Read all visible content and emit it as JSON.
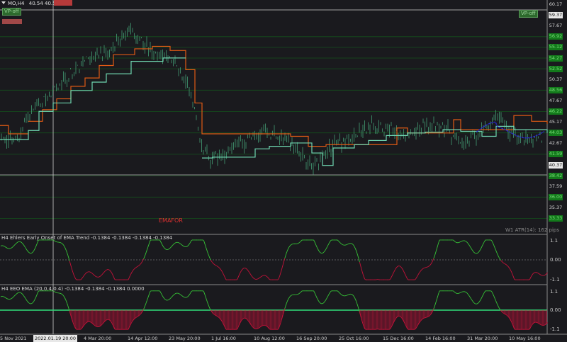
{
  "header": {
    "symbol": "MO,H4",
    "quote": "40.54 40.54 40.5",
    "sell_badge": "",
    "buy_badge": ""
  },
  "chart_buttons": {
    "vp_off_left": "VP-off",
    "vp_off_right": "VP-off",
    "red_label": "",
    "emafor": "EMAFOR",
    "atr": "W1 ATR(14): 162 pips"
  },
  "price_scale": [
    {
      "text": "60.17",
      "style": "plain"
    },
    {
      "text": "59.37",
      "style": "white"
    },
    {
      "text": "57.67",
      "style": "plain"
    },
    {
      "text": "56.92",
      "style": "green"
    },
    {
      "text": "55.12",
      "style": "green"
    },
    {
      "text": "54.27",
      "style": "green"
    },
    {
      "text": "52.52",
      "style": "green"
    },
    {
      "text": "50.37",
      "style": "plain"
    },
    {
      "text": "48.56",
      "style": "green"
    },
    {
      "text": "47.67",
      "style": "plain"
    },
    {
      "text": "46.22",
      "style": "green"
    },
    {
      "text": "45.17",
      "style": "plain"
    },
    {
      "text": "44.03",
      "style": "green"
    },
    {
      "text": "42.67",
      "style": "plain"
    },
    {
      "text": "41.59",
      "style": "green"
    },
    {
      "text": "40.37",
      "style": "white"
    },
    {
      "text": "38.42",
      "style": "green"
    },
    {
      "text": "37.59",
      "style": "plain"
    },
    {
      "text": "36.00",
      "style": "green"
    },
    {
      "text": "35.37",
      "style": "plain"
    },
    {
      "text": "33.33",
      "style": "green"
    }
  ],
  "indicator1": {
    "title": "H4 Ehlers Early Onset of EMA Trend -0.1384 -0.1384 -0.1384 -0.1384",
    "levels": [
      "1.1",
      "0.00",
      "-1.1"
    ]
  },
  "indicator2": {
    "title": "H4 EEO EMA (20,0.4,0.4) -0.1384 -0.1384 -0.1384 0.0000",
    "levels": [
      "1.1",
      "0.00",
      "-1.1"
    ]
  },
  "time_axis": [
    {
      "text": "5 Nov 2021"
    },
    {
      "text": "2022.01.19 20:00",
      "highlight": true
    },
    {
      "text": "4 Mar 20:00"
    },
    {
      "text": "14 Apr 12:00"
    },
    {
      "text": "23 May 20:00"
    },
    {
      "text": "1 Jul 16:00"
    },
    {
      "text": "10 Aug 12:00"
    },
    {
      "text": "16 Sep 20:00"
    },
    {
      "text": "25 Oct 16:00"
    },
    {
      "text": "15 Dec 16:00"
    },
    {
      "text": "14 Feb 16:00"
    },
    {
      "text": "31 Mar 20:00"
    },
    {
      "text": "10 May 16:00"
    }
  ],
  "colors": {
    "bg": "#1a1a1e",
    "candle": "#3f8f6a",
    "stop_red": "#e05a14",
    "stop_teal": "#6fd6b0",
    "ema_blue": "#2a2ad8",
    "osc_green": "#37c637",
    "osc_red": "#c8123a",
    "zero_line": "#2fe07a",
    "grid": "#14501c"
  }
}
